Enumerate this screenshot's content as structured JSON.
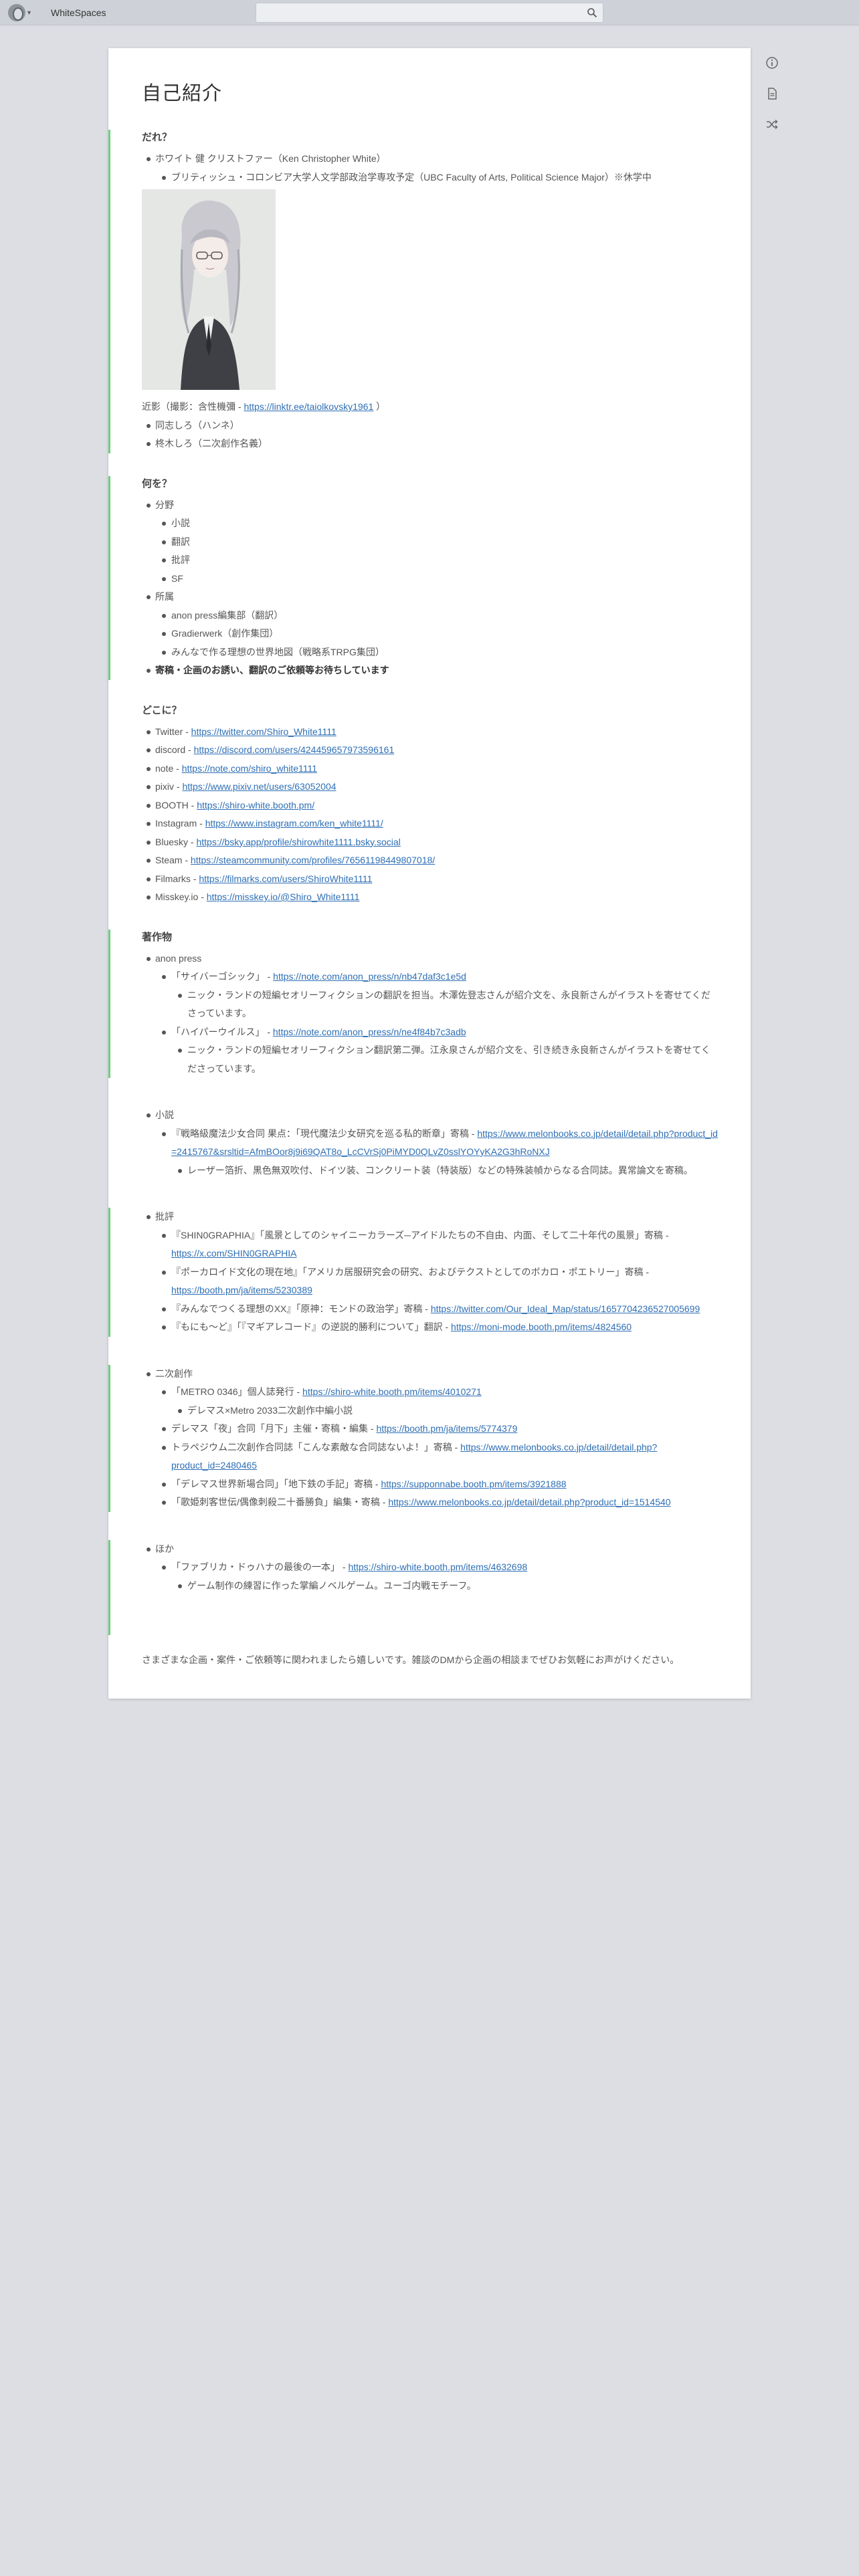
{
  "app": {
    "title": "WhiteSpaces"
  },
  "search": {
    "placeholder": ""
  },
  "page": {
    "title": "自己紹介",
    "who": {
      "heading": "だれ？",
      "name": "ホワイト 健 クリストファー（Ken Christopher White）",
      "school": "ブリティッシュ・コロンビア大学人文学部政治学専攻予定（UBC Faculty of Arts, Political Science Major）※休学中",
      "caption_prefix": "近影（撮影：含性機彌 - ",
      "caption_link": "https://linktr.ee/taiolkovsky1961",
      "caption_suffix": " ）",
      "aliases": [
        "同志しろ（ハンネ）",
        "柊木しろ（二次創作名義）"
      ]
    },
    "what": {
      "heading": "何を？",
      "field_label": "分野",
      "fields": [
        "小説",
        "翻訳",
        "批評",
        "SF"
      ],
      "belong_label": "所属",
      "belongs": [
        "anon press編集部（翻訳）",
        "Gradierwerk（創作集団）",
        "みんなで作る理想の世界地図（戦略系TRPG集団）"
      ],
      "notice": "寄稿・企画のお誘い、翻訳のご依頼等お待ちしています"
    },
    "where": {
      "heading": "どこに？",
      "links": [
        {
          "label": "Twitter - ",
          "url": "https://twitter.com/Shiro_White1111"
        },
        {
          "label": "discord - ",
          "url": "https://discord.com/users/424459657973596161"
        },
        {
          "label": "note - ",
          "url": "https://note.com/shiro_white1111"
        },
        {
          "label": "pixiv - ",
          "url": "https://www.pixiv.net/users/63052004"
        },
        {
          "label": "BOOTH - ",
          "url": "https://shiro-white.booth.pm/"
        },
        {
          "label": "Instagram - ",
          "url": "https://www.instagram.com/ken_white1111/"
        },
        {
          "label": "Bluesky - ",
          "url": "https://bsky.app/profile/shirowhite1111.bsky.social"
        },
        {
          "label": "Steam - ",
          "url": "https://steamcommunity.com/profiles/76561198449807018/"
        },
        {
          "label": "Filmarks - ",
          "url": "https://filmarks.com/users/ShiroWhite1111"
        },
        {
          "label": "Misskey.io - ",
          "url": "https://misskey.io/@Shiro_White1111"
        }
      ]
    },
    "works": {
      "heading": "著作物",
      "anon_label": "anon press",
      "anon": [
        {
          "title": "「サイバーゴシック」 - ",
          "url": "https://note.com/anon_press/n/nb47daf3c1e5d",
          "note": "ニック・ランドの短編セオリーフィクションの翻訳を担当。木澤佐登志さんが紹介文を、永良新さんがイラストを寄せてくださっています。"
        },
        {
          "title": "「ハイパーウイルス」 - ",
          "url": "https://note.com/anon_press/n/ne4f84b7c3adb",
          "note": "ニック・ランドの短編セオリーフィクション翻訳第二弾。江永泉さんが紹介文を、引き続き永良新さんがイラストを寄せてくださっています。"
        }
      ],
      "novel_label": "小説",
      "novels": [
        {
          "title": "『戦略級魔法少女合同 果点：「現代魔法少女研究を巡る私的断章」寄稿 - ",
          "url": "https://www.melonbooks.co.jp/detail/detail.php?product_id=2415767&srsltid=AfmBOor8j9i69QAT8o_LcCVrSj0PiMYD0QLvZ0sslYOYyKA2G3hRoNXJ",
          "note": "レーザー箔折、黒色無双吹付、ドイツ装、コンクリート装（特装版）などの特殊装幀からなる合同誌。異常論文を寄稿。"
        }
      ],
      "critique_label": "批評",
      "critiques": [
        {
          "title": "『SHIN0GRAPHIA』「風景としてのシャイニーカラーズ─アイドルたちの不自由、内面、そして二十年代の風景」寄稿 - ",
          "url": "https://x.com/SHIN0GRAPHIA"
        },
        {
          "title": "『ポーカロイド文化の現在地』「アメリカ居服研究会の研究、およびテクストとしてのボカロ・ポエトリー」寄稿 - ",
          "url": "https://booth.pm/ja/items/5230389"
        },
        {
          "title": "『みんなでつくる理想のXX』「原神：モンドの政治学」寄稿 - ",
          "url": "https://twitter.com/Our_Ideal_Map/status/1657704236527005699"
        },
        {
          "title": "『もにも〜ど』「『マギアレコード』の逆説的勝利について」翻訳 - ",
          "url": "https://moni-mode.booth.pm/items/4824560"
        }
      ],
      "fan_label": "二次創作",
      "fan": [
        {
          "title": "「METRO 0346」個人誌発行 - ",
          "url": "https://shiro-white.booth.pm/items/4010271",
          "sub": "デレマス×Metro 2033二次創作中編小説"
        },
        {
          "title": "デレマス「夜」合同「月下」主催・寄稿・編集 - ",
          "url": "https://booth.pm/ja/items/5774379"
        },
        {
          "title": "トラペジウム二次創作合同誌「こんな素敵な合同誌ないよ！」寄稿 - ",
          "url": "https://www.melonbooks.co.jp/detail/detail.php?product_id=2480465"
        },
        {
          "title": "「デレマス世界新場合同」「地下鉄の手記」寄稿 - ",
          "url": "https://supponnabe.booth.pm/items/3921888"
        },
        {
          "title": "「歌姫刺客世伝/偶像刺殺二十番勝負」編集・寄稿 - ",
          "url": "https://www.melonbooks.co.jp/detail/detail.php?product_id=1514540"
        }
      ],
      "other_label": "ほか",
      "others": [
        {
          "title": "「ファブリカ・ドゥハナの最後の一本」 - ",
          "url": "https://shiro-white.booth.pm/items/4632698",
          "sub": "ゲーム制作の練習に作った掌編ノベルゲーム。ユーゴ内戦モチーフ。"
        }
      ]
    },
    "closing": "さまざまな企画・案件・ご依頼等に関われましたら嬉しいです。雑談のDMから企画の相談までぜひお気軽にお声がけください。"
  }
}
